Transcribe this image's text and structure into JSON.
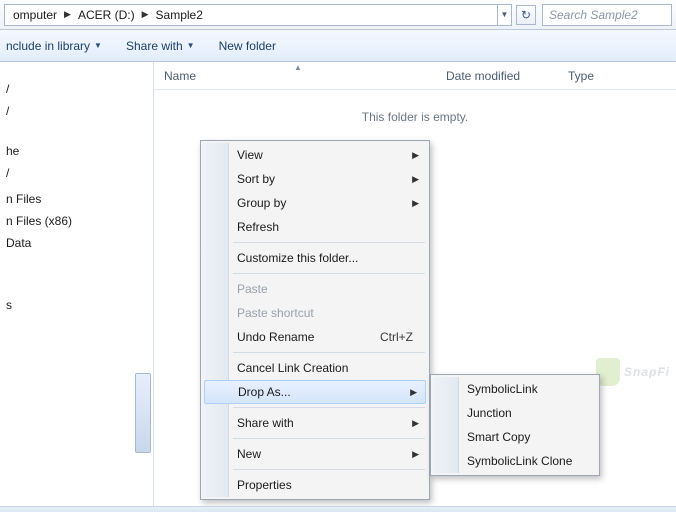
{
  "breadcrumbs": {
    "seg0": "omputer",
    "seg1": "ACER (D:)",
    "seg2": "Sample2"
  },
  "search": {
    "placeholder": "Search Sample2"
  },
  "toolbar": {
    "include": "nclude in library",
    "share": "Share with",
    "newfolder": "New folder"
  },
  "columns": {
    "name": "Name",
    "date": "Date modified",
    "type": "Type"
  },
  "empty_text": "This folder is empty.",
  "nav": {
    "r0": "/",
    "r1": "/",
    "r2": "he",
    "r3": "/",
    "r4": "n Files",
    "r5": "n Files (x86)",
    "r6": "Data",
    "r7": "s"
  },
  "menu": {
    "view": "View",
    "sortby": "Sort by",
    "groupby": "Group by",
    "refresh": "Refresh",
    "customize": "Customize this folder...",
    "paste": "Paste",
    "paste_shortcut": "Paste shortcut",
    "undo": "Undo Rename",
    "undo_key": "Ctrl+Z",
    "cancel_link": "Cancel Link Creation",
    "drop_as": "Drop As...",
    "sharewith": "Share with",
    "new": "New",
    "properties": "Properties"
  },
  "submenu": {
    "symlink": "SymbolicLink",
    "junction": "Junction",
    "smartcopy": "Smart Copy",
    "symclone": "SymbolicLink Clone"
  },
  "watermark": "SnapFi"
}
